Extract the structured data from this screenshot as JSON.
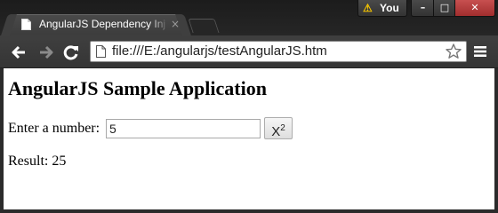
{
  "browser": {
    "tab_title": "AngularJS Dependency Inj",
    "tab_close": "×",
    "profile_label": "You",
    "address": "file:///E:/angularjs/testAngularJS.htm",
    "window_controls": {
      "minimize": "–",
      "maximize": "□",
      "close": "✕"
    },
    "icons": [
      "page-icon",
      "close-icon",
      "warning-icon",
      "back-icon",
      "forward-icon",
      "reload-icon",
      "star-icon",
      "menu-icon"
    ]
  },
  "page": {
    "heading": "AngularJS Sample Application",
    "number_label": "Enter a number:",
    "number_value": "5",
    "square_button": {
      "base": "X",
      "exponent": "2"
    },
    "result_label": "Result:",
    "result_value": "25"
  }
}
